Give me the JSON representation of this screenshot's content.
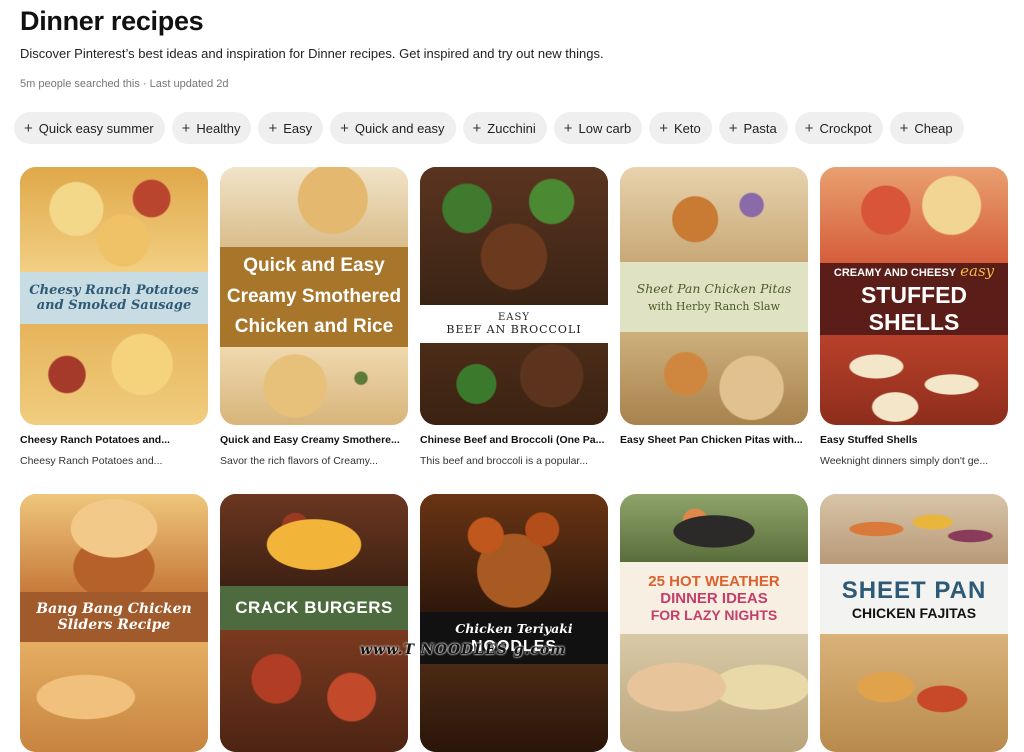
{
  "header": {
    "title": "Dinner recipes",
    "description": "Discover Pinterest’s best ideas and inspiration for Dinner recipes. Get inspired and try out new things.",
    "meta": "5m people searched this · Last updated 2d"
  },
  "chips": [
    {
      "label": "Quick easy summer"
    },
    {
      "label": "Healthy"
    },
    {
      "label": "Easy"
    },
    {
      "label": "Quick and easy"
    },
    {
      "label": "Zucchini"
    },
    {
      "label": "Low carb"
    },
    {
      "label": "Keto"
    },
    {
      "label": "Pasta"
    },
    {
      "label": "Crockpot"
    },
    {
      "label": "Cheap"
    }
  ],
  "chip_icon": "plus-icon",
  "pins_row1": [
    {
      "title": "Cheesy Ranch Potatoes and...",
      "subtitle": "Cheesy Ranch Potatoes and...",
      "overlay": [
        "Cheesy Ranch Potatoes",
        "and Smoked Sausage"
      ]
    },
    {
      "title": "Quick and Easy Creamy Smothere...",
      "subtitle": "Savor the rich flavors of Creamy...",
      "overlay": [
        "Quick and Easy",
        "Creamy Smothered",
        "Chicken and Rice"
      ]
    },
    {
      "title": "Chinese Beef and Broccoli (One Pa...",
      "subtitle": "This beef and broccoli is a popular...",
      "overlay": [
        "EASY",
        "BEEF AN BROCCOLI"
      ]
    },
    {
      "title": "Easy Sheet Pan Chicken Pitas with...",
      "subtitle": "",
      "overlay": [
        "Sheet Pan Chicken Pitas",
        "with Herby Ranch Slaw"
      ]
    },
    {
      "title": "Easy Stuffed Shells",
      "subtitle": "Weeknight dinners simply don't ge...",
      "overlay": [
        "CREAMY AND CHEESY",
        "easy",
        "STUFFED SHELLS"
      ]
    }
  ],
  "pins_row2": [
    {
      "overlay": [
        "Bang Bang Chicken",
        "Sliders Recipe"
      ]
    },
    {
      "overlay": [
        "CRACK BURGERS"
      ]
    },
    {
      "overlay": [
        "Chicken Teriyaki",
        "NOODLES"
      ]
    },
    {
      "overlay": [
        "25 HOT WEATHER",
        "DINNER IDEAS",
        "FOR LAZY NIGHTS"
      ]
    },
    {
      "overlay": [
        "SHEET PAN",
        "CHICKEN FAJITAS"
      ]
    }
  ],
  "watermark": "www.T          NOODLES          g.com",
  "colors": {
    "chip_bg": "#efefef",
    "meta_text": "#767676"
  }
}
